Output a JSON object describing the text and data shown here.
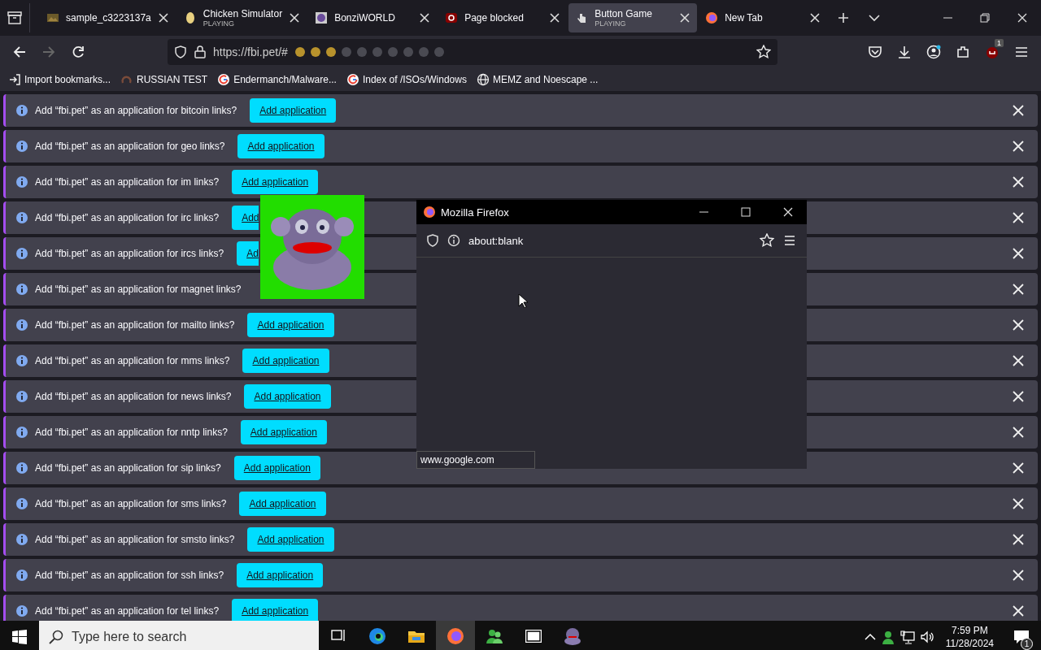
{
  "tabs": [
    {
      "title": "sample_c3223137a",
      "kind": "image",
      "selected": false
    },
    {
      "title": "Chicken Simulator",
      "subtitle": "PLAYING",
      "kind": "chicken",
      "selected": false
    },
    {
      "title": "BonziWORLD",
      "kind": "bonzi",
      "selected": false
    },
    {
      "title": "Page blocked",
      "kind": "blocked",
      "selected": false
    },
    {
      "title": "Button Game",
      "subtitle": "PLAYING",
      "kind": "hand",
      "selected": true
    },
    {
      "title": "New Tab",
      "kind": "firefox",
      "selected": false
    }
  ],
  "address": {
    "url": "https://fbi.pet/#"
  },
  "extension_badge": "1",
  "bookmarks": [
    {
      "label": "Import bookmarks...",
      "kind": "import"
    },
    {
      "label": "RUSSIAN TEST",
      "kind": "swirl"
    },
    {
      "label": "Endermanch/Malware...",
      "kind": "google"
    },
    {
      "label": "Index of /ISOs/Windows",
      "kind": "google"
    },
    {
      "label": "MEMZ and Noescape ...",
      "kind": "globe"
    }
  ],
  "notifications": [
    {
      "message": "Add “fbi.pet” as an application for bitcoin links?",
      "button": "Add application"
    },
    {
      "message": "Add “fbi.pet” as an application for geo links?",
      "button": "Add application"
    },
    {
      "message": "Add “fbi.pet” as an application for im links?",
      "button": "Add application"
    },
    {
      "message": "Add “fbi.pet” as an application for irc links?",
      "button": "Add",
      "button_cut": true
    },
    {
      "message": "Add “fbi.pet” as an application for ircs links?",
      "button": "Ad",
      "button_cut": true
    },
    {
      "message": "Add “fbi.pet” as an application for magnet links?"
    },
    {
      "message": "Add “fbi.pet” as an application for mailto links?",
      "button": "Add application"
    },
    {
      "message": "Add “fbi.pet” as an application for mms links?",
      "button": "Add application"
    },
    {
      "message": "Add “fbi.pet” as an application for news links?",
      "button": "Add application"
    },
    {
      "message": "Add “fbi.pet” as an application for nntp links?",
      "button": "Add application"
    },
    {
      "message": "Add “fbi.pet” as an application for sip links?",
      "button": "Add application"
    },
    {
      "message": "Add “fbi.pet” as an application for sms links?",
      "button": "Add application"
    },
    {
      "message": "Add “fbi.pet” as an application for smsto links?",
      "button": "Add application"
    },
    {
      "message": "Add “fbi.pet” as an application for ssh links?",
      "button": "Add application"
    },
    {
      "message": "Add “fbi.pet” as an application for tel links?",
      "button": "Add application"
    }
  ],
  "popup": {
    "title": "Mozilla Firefox",
    "url": "about:blank",
    "status": "www.google.com"
  },
  "taskbar": {
    "search": {
      "placeholder": "Type here to search"
    },
    "apps": [
      {
        "kind": "taskview",
        "selected": false
      },
      {
        "kind": "edge",
        "selected": false
      },
      {
        "kind": "folder",
        "selected": false
      },
      {
        "kind": "firefox",
        "selected": true
      },
      {
        "kind": "people",
        "selected": false
      },
      {
        "kind": "archive",
        "selected": false
      },
      {
        "kind": "bonzi",
        "selected": false
      }
    ],
    "time": "7:59 PM",
    "date": "11/28/2024",
    "notification_count": "1"
  }
}
